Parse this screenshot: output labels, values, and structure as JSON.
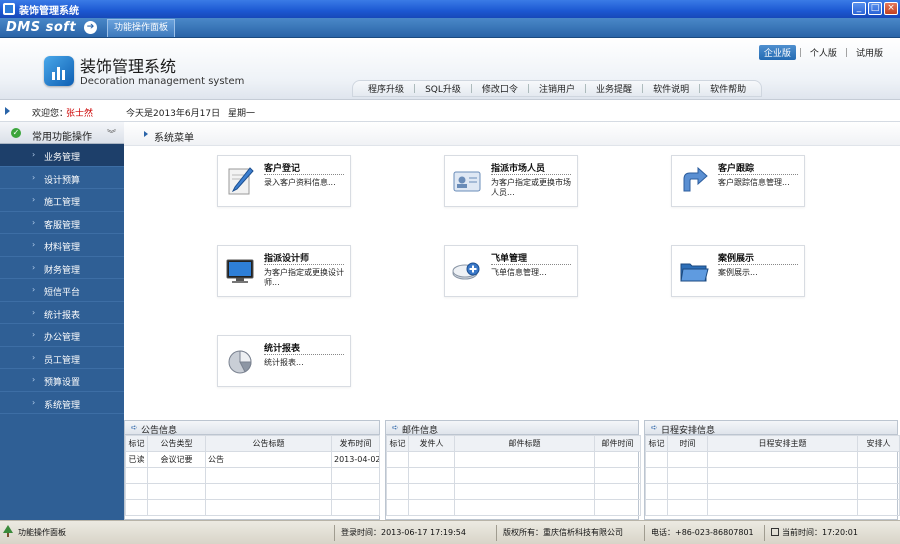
{
  "window": {
    "title": "装饰管理系统"
  },
  "tabstrip": {
    "brand": "DMS soft",
    "tab": "功能操作面板"
  },
  "header": {
    "title": "装饰管理系统",
    "subtitle": "Decoration management system",
    "editions": [
      "企业版",
      "个人版",
      "试用版"
    ],
    "menu": [
      "程序升级",
      "SQL升级",
      "修改口令",
      "注销用户",
      "业务提醒",
      "软件说明",
      "软件帮助"
    ]
  },
  "welcome": {
    "greeting": "欢迎您：",
    "user": "张士然",
    "date": "今天是2013年6月17日",
    "weekday": "星期一"
  },
  "sidebar": {
    "header": "常用功能操作",
    "items": [
      "业务管理",
      "设计预算",
      "施工管理",
      "客服管理",
      "材料管理",
      "财务管理",
      "短信平台",
      "统计报表",
      "办公管理",
      "员工管理",
      "预算设置",
      "系统管理"
    ]
  },
  "main": {
    "title": "系统菜单",
    "cards": [
      {
        "title": "客户登记",
        "desc": "录入客户资料信息...",
        "icon": "pen-paper-icon"
      },
      {
        "title": "指派市场人员",
        "desc": "为客户指定或更换市场人员...",
        "icon": "id-card-icon"
      },
      {
        "title": "客户跟踪",
        "desc": "客户跟踪信息管理...",
        "icon": "arrow-icon"
      },
      {
        "title": "指派设计师",
        "desc": "为客户指定或更换设计师...",
        "icon": "monitor-icon"
      },
      {
        "title": "飞单管理",
        "desc": "飞单信息管理...",
        "icon": "disk-add-icon"
      },
      {
        "title": "案例展示",
        "desc": "案例展示...",
        "icon": "folder-icon"
      },
      {
        "title": "统计报表",
        "desc": "统计报表...",
        "icon": "pie-chart-icon"
      }
    ]
  },
  "panels": {
    "notice": {
      "title": "公告信息",
      "columns": [
        "标记",
        "公告类型",
        "公告标题",
        "发布时间"
      ],
      "rows": [
        [
          "已读",
          "会议记要",
          "公告",
          "2013-04-02"
        ]
      ]
    },
    "mail": {
      "title": "邮件信息",
      "columns": [
        "标记",
        "发件人",
        "邮件标题",
        "邮件时间"
      ],
      "rows": []
    },
    "schedule": {
      "title": "日程安排信息",
      "columns": [
        "标记",
        "时间",
        "日程安排主题",
        "安排人"
      ],
      "rows": []
    }
  },
  "statusbar": {
    "panel": "功能操作面板",
    "login": "登录时间：2013-06-17 17:19:54",
    "copyright": "版权所有：重庆信析科技有限公司",
    "phone": "电话：+86-023-86807801",
    "now": "当前时间：17:20:01"
  },
  "colors": {
    "accent": "#2a64a8",
    "sidebar": "#2f5f95",
    "user": "#cc0000"
  }
}
